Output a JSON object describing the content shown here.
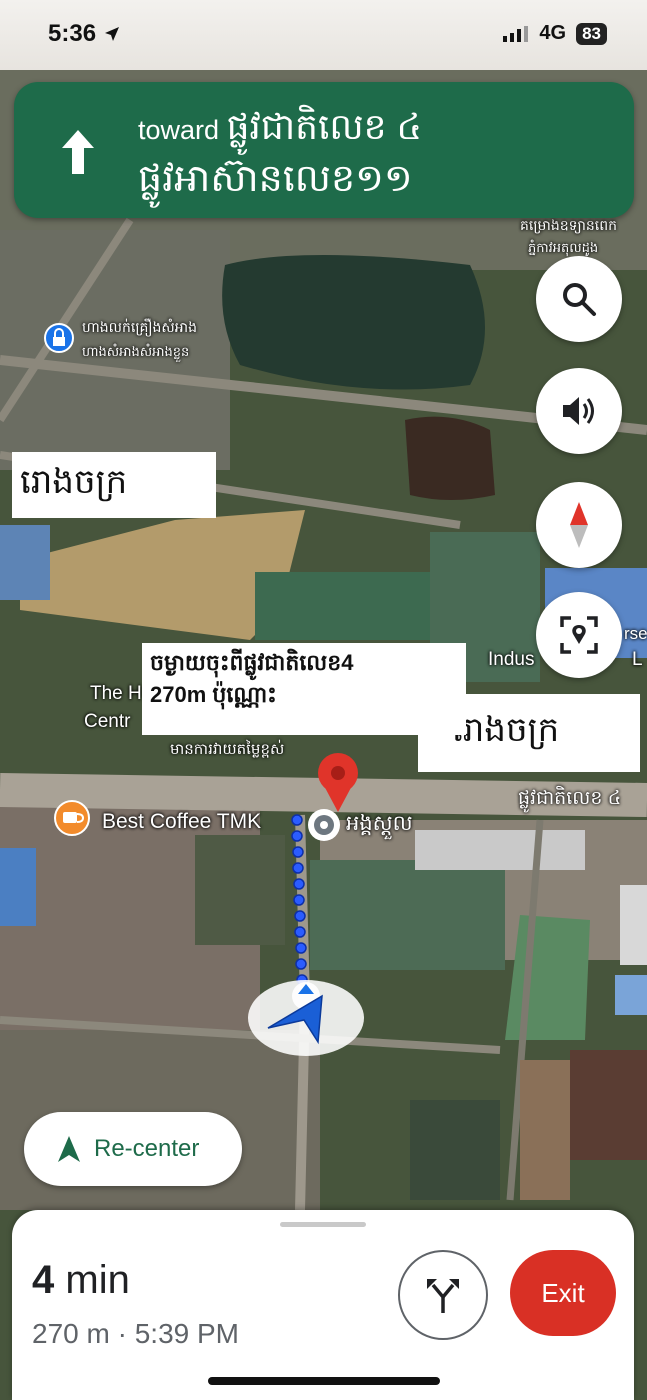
{
  "status_bar": {
    "time": "5:36",
    "network": "4G",
    "battery": "83"
  },
  "nav_banner": {
    "toward_prefix": "toward",
    "road_primary": "ផ្លូវជាតិលេខ ៤",
    "road_secondary": "ផ្លូវអាស៊ានលេខ១១"
  },
  "map_labels": {
    "poi_top_right_1": "គម្រោងឧទ្យានពេក",
    "poi_top_right_2": "ភ្នំកាវអតុលដូង",
    "poi_shop_1": "ហាងលក់គ្រឿងសំអាង",
    "poi_shop_2": "ហាងសំអាងសំអាងខ្លួន",
    "poi_left_1": "The H",
    "poi_left_2": "Centr",
    "poi_industrial": "Indus",
    "poi_industrial_suffix": "rse",
    "poi_industrial_suffix2": "L",
    "poi_center": "មានការវាយតម្លៃខ្ពស់",
    "coffee": "Best Coffee TMK",
    "destination_label": "អង្គស្តួល",
    "road_right": "ផ្លូវជាតិលេខ ៤"
  },
  "annotations": {
    "factory_left": "រោងចក្រ",
    "factory_right": "រោងចក្រ",
    "distance_note_line1": "ចម្ងាយចុះពីផ្លូវជាតិលេខ4",
    "distance_note_line2": "270m ប៉ុណ្ណោះ"
  },
  "buttons": {
    "recenter": "Re-center",
    "exit": "Exit"
  },
  "trip": {
    "duration_value": "4",
    "duration_unit": "min",
    "distance": "270 m",
    "separator": "·",
    "arrival": "5:39 PM"
  },
  "colors": {
    "nav_green": "#1e6b4a",
    "exit_red": "#d93025",
    "route_blue": "#2b5cff"
  },
  "icons": {
    "banner_arrow": "arrow-up-icon",
    "search": "search-icon",
    "sound": "volume-icon",
    "compass": "compass-icon",
    "location": "location-target-icon",
    "recenter": "navigation-arrow-icon",
    "alternates": "alternate-routes-icon",
    "destination": "destination-pin-icon",
    "coffee": "coffee-cup-icon",
    "parking": "lock-pin-icon"
  }
}
